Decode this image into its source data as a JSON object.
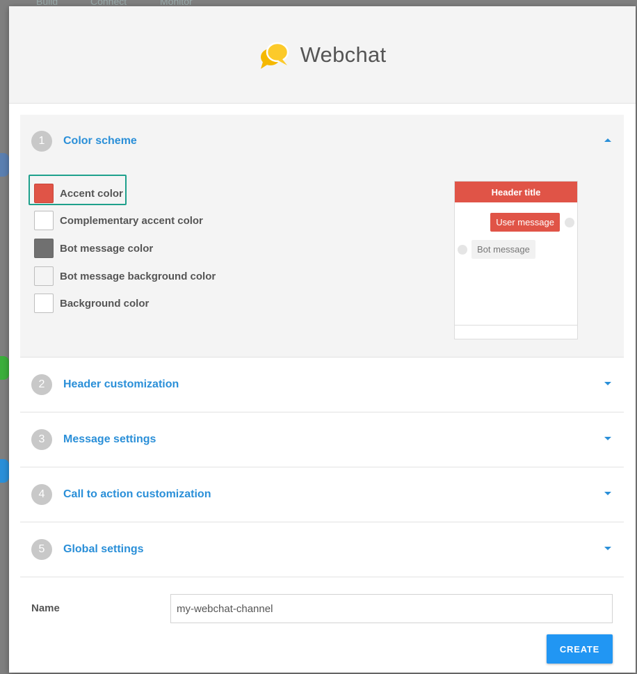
{
  "background_tabs": [
    "Build",
    "Connect",
    "Monitor"
  ],
  "modal": {
    "title": "Webchat",
    "logo_icon": "chat-bubbles-icon"
  },
  "sections": [
    {
      "number": "1",
      "title": "Color scheme",
      "expanded": true
    },
    {
      "number": "2",
      "title": "Header customization",
      "expanded": false
    },
    {
      "number": "3",
      "title": "Message settings",
      "expanded": false
    },
    {
      "number": "4",
      "title": "Call to action customization",
      "expanded": false
    },
    {
      "number": "5",
      "title": "Global settings",
      "expanded": false
    }
  ],
  "color_scheme": {
    "items": [
      {
        "label": "Accent color",
        "color": "#e05447",
        "selected": true
      },
      {
        "label": "Complementary accent color",
        "color": "#ffffff",
        "selected": false
      },
      {
        "label": "Bot message color",
        "color": "#707070",
        "selected": false
      },
      {
        "label": "Bot message background color",
        "color": "#f4f4f4",
        "selected": false
      },
      {
        "label": "Background color",
        "color": "#ffffff",
        "selected": false
      }
    ]
  },
  "preview": {
    "header_title": "Header title",
    "user_message": "User message",
    "bot_message": "Bot message"
  },
  "form": {
    "name_label": "Name",
    "name_value": "my-webchat-channel"
  },
  "create_label": "CREATE",
  "colors": {
    "accent": "#e05447",
    "link": "#2a8fd8",
    "button": "#2196f3",
    "selection_outline": "#1ea08c",
    "logo": "#f5b800"
  }
}
